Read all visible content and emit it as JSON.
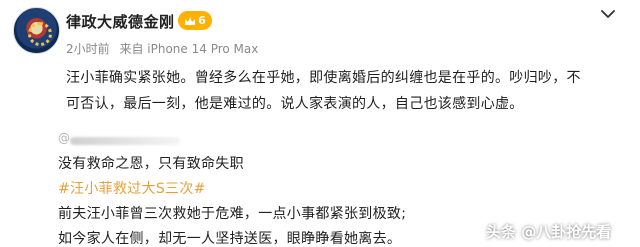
{
  "post": {
    "username": "律政大威德金刚",
    "badge_level": "6",
    "time": "2小时前",
    "source": "来自 iPhone 14 Pro Max",
    "body_line1": "汪小菲确实紧张她。曾经多么在乎她，即使离婚后的纠缠也是在乎的。吵归吵，不",
    "body_line2": "可否认，最后一刻，他是难过的。说人家表演的人，自己也该感到心虚。"
  },
  "quote": {
    "at_symbol": "@",
    "line1": "没有救命之恩，只有致命失职",
    "hashtag": "#汪小菲救过大S三次#",
    "line3": "前夫汪小菲曾三次救她于危难，一点小事都紧张到极致;",
    "line4": "如今家人在侧，却无一人坚持送医，眼睁睁看她离去。"
  },
  "watermark": {
    "text": "头条 @八卦抢先看"
  },
  "colors": {
    "badge": "#ffb000",
    "hashtag": "#e8a13a",
    "meta": "#8a8a8a"
  }
}
